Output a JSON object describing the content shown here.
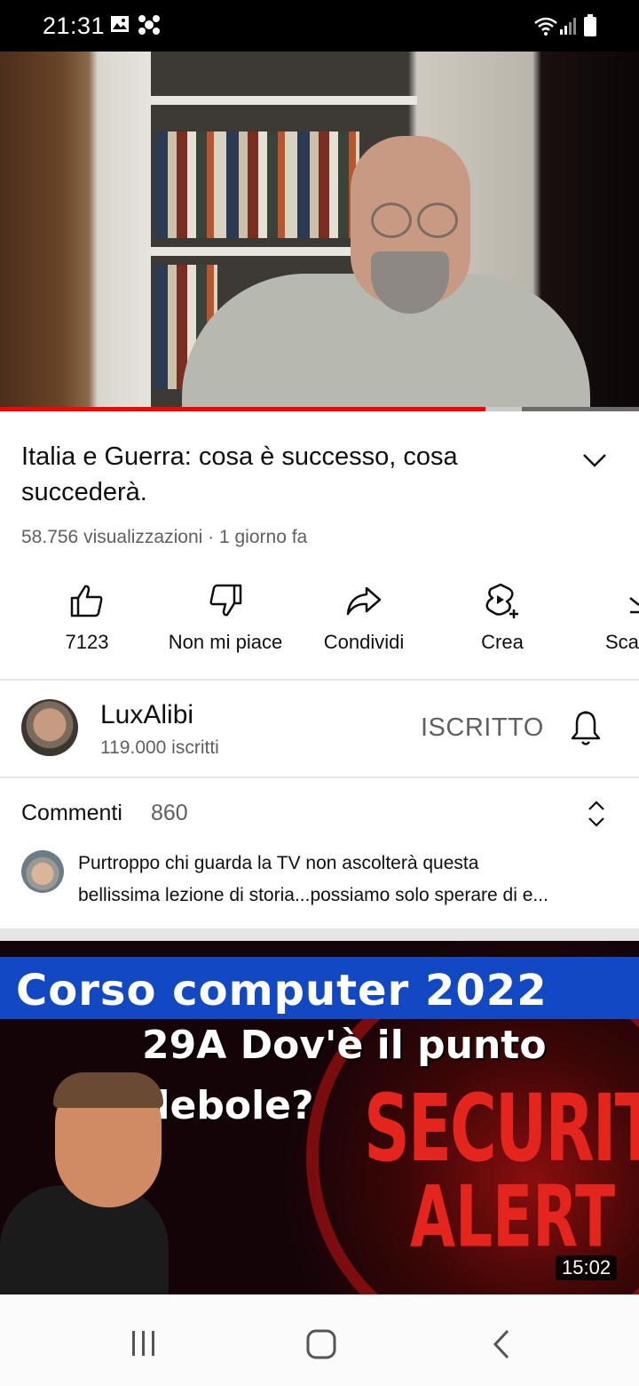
{
  "status_bar": {
    "time": "21:31"
  },
  "video": {
    "title": "Italia e Guerra: cosa è successo, cosa succederà.",
    "views": "58.756 visualizzazioni",
    "age": "1 giorno fa",
    "meta_separator": "·",
    "progress_fraction": 0.76
  },
  "actions": {
    "like_label": "7123",
    "dislike_label": "Non mi piace",
    "share_label": "Condividi",
    "create_label": "Crea",
    "save_label": "Sca"
  },
  "channel": {
    "name": "LuxAlibi",
    "subscribers": "119.000 iscritti",
    "subscribed_label": "ISCRITTO"
  },
  "comments": {
    "title": "Commenti",
    "count": "860",
    "top_comment_line1": "Purtroppo chi guarda la TV non ascolterà questa",
    "top_comment_line2": "bellissima lezione di storia...possiamo solo sperare di e..."
  },
  "next_video": {
    "thumb_banner": "Corso computer 2022",
    "thumb_line1": "29A Dov'è il punto",
    "thumb_line2": "debole?",
    "thumb_security": "SECURITY",
    "thumb_alert": "ALERT",
    "duration": "15:02"
  },
  "colors": {
    "progress": "#ff0000",
    "banner_blue": "#1248c4",
    "alert_red": "#e4251d",
    "secondary_text": "#606060"
  }
}
